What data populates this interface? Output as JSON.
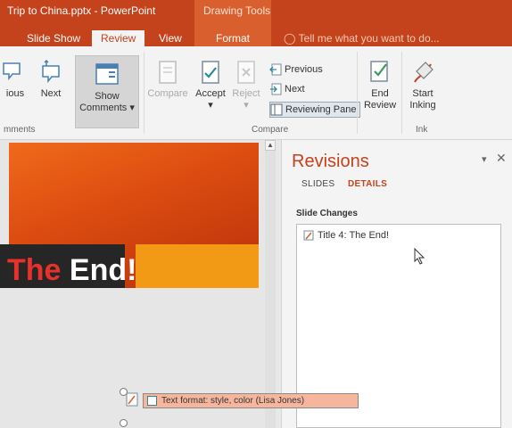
{
  "window": {
    "title": "Trip to China.pptx - PowerPoint",
    "context_tab_group": "Drawing Tools"
  },
  "tabs": [
    {
      "label": "Slide Show"
    },
    {
      "label": "Review",
      "active": true
    },
    {
      "label": "View"
    },
    {
      "label": "Format"
    }
  ],
  "tell_me": "Tell me what you want to do...",
  "ribbon": {
    "previous_partial": "ious",
    "next": "Next",
    "show_comments_line1": "Show",
    "show_comments_line2": "Comments",
    "comments_group": "mments",
    "compare": "Compare",
    "accept": "Accept",
    "reject": "Reject",
    "previous": "Previous",
    "next_small": "Next",
    "reviewing_pane": "Reviewing Pane",
    "end_review_line1": "End",
    "end_review_line2": "Review",
    "compare_group": "Compare",
    "start_inking_line1": "Start",
    "start_inking_line2": "Inking",
    "ink_group": "Ink"
  },
  "slide": {
    "title_red": "The",
    "title_white": " End!"
  },
  "revisions_pane": {
    "title": "Revisions",
    "tabs": [
      "SLIDES",
      "DETAILS"
    ],
    "active_tab": "DETAILS",
    "section_label": "Slide Changes",
    "items": [
      {
        "label": "Title 4: The End!"
      }
    ]
  },
  "tooltip": {
    "text": "Text format: style, color (Lisa Jones)"
  },
  "colors": {
    "accent": "#c4421c",
    "tooltip_bg": "#f6b69e",
    "slide_orange": "#f29a16"
  }
}
